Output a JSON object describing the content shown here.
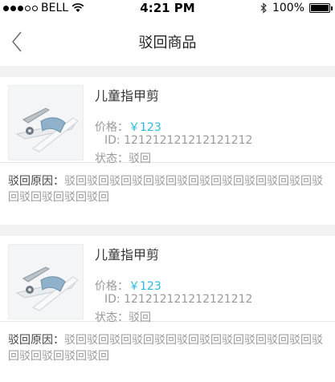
{
  "status_bar": {
    "carrier": "BELL",
    "time": "4:21 PM",
    "battery": "100%"
  },
  "nav": {
    "title": "驳回商品"
  },
  "items": [
    {
      "name": "儿童指甲剪",
      "price_label": "价格：",
      "price": "￥123",
      "id_label": "ID:",
      "id": "121212121212121212",
      "status_label": "状态：",
      "status": "驳回",
      "reason_label": "驳回原因：",
      "reason": "驳回驳回驳回驳回驳回驳回驳回驳回驳回驳回驳回驳回驳回驳回驳回驳回"
    },
    {
      "name": "儿童指甲剪",
      "price_label": "价格：",
      "price": "￥123",
      "id_label": "ID:",
      "id": "121212121212121212",
      "status_label": "状态：",
      "status": "驳回",
      "reason_label": "驳回原因：",
      "reason": "驳回驳回驳回驳回驳回驳回驳回驳回驳回驳回驳回驳回驳回驳回驳回驳回"
    }
  ],
  "colors": {
    "price": "#29b7e6",
    "separator": "#f2f2f2"
  }
}
